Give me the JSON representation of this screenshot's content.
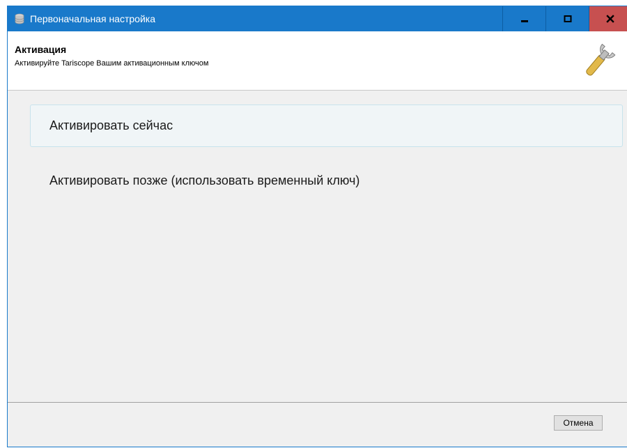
{
  "window": {
    "title": "Первоначальная настройка",
    "icons": {
      "app": "database-icon",
      "minimize": "minimize-icon",
      "maximize": "maximize-icon",
      "close": "close-icon"
    },
    "colors": {
      "titlebar": "#1979ca",
      "close_button": "#c75050"
    }
  },
  "header": {
    "title": "Активация",
    "subtitle": "Активируйте Tariscope Вашим активационным ключом",
    "icon": "wrench-icon"
  },
  "options": [
    {
      "label": "Активировать сейчас",
      "selected": true
    },
    {
      "label": "Активировать позже (использовать временный ключ)",
      "selected": false
    }
  ],
  "footer": {
    "cancel_label": "Отмена"
  }
}
